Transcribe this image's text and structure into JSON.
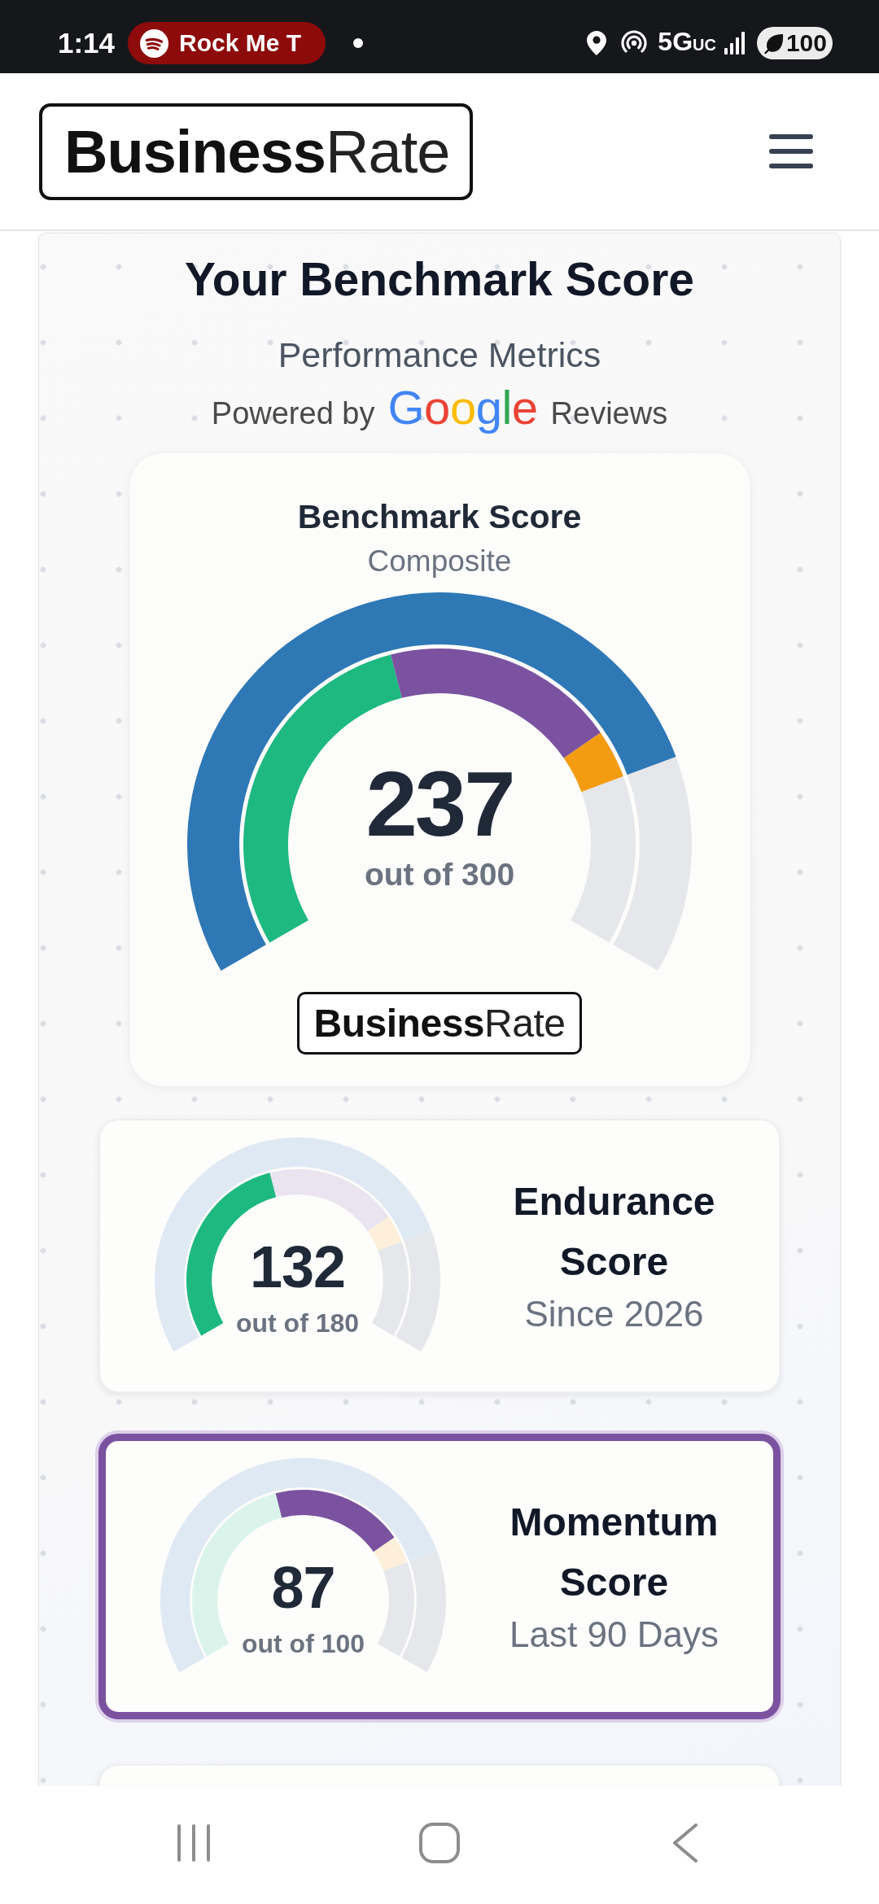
{
  "status_bar": {
    "time": "1:14",
    "media_title": "Rock Me T",
    "network": "5G",
    "network_suffix": "UC",
    "battery": "100"
  },
  "header": {
    "logo": {
      "bold": "Business",
      "light": "Rate"
    }
  },
  "intro": {
    "title": "Your Benchmark Score",
    "subtitle": "Performance Metrics",
    "powered_by": "Powered by",
    "brand": "Google",
    "source": "Reviews"
  },
  "benchmark": {
    "title": "Benchmark Score",
    "subtitle": "Composite",
    "score": "237",
    "out_of": "out of 300",
    "gauge": {
      "segments": [
        {
          "color": "#1db981"
        },
        {
          "color": "#7b52a0"
        },
        {
          "color": "#f39c12"
        }
      ]
    },
    "logo": {
      "bold": "Business",
      "light": "Rate"
    }
  },
  "score_cards": [
    {
      "title": "Endurance Score",
      "subtitle": "Since 2026",
      "score": "132",
      "out_of": "out of 180",
      "selected": false,
      "gauge": {
        "total_highlighted": false,
        "segments": [
          {
            "highlighted": true
          },
          {
            "highlighted": false
          },
          {
            "highlighted": false
          }
        ]
      }
    },
    {
      "title": "Momentum Score",
      "subtitle": "Last 90 Days",
      "score": "87",
      "out_of": "out of 100",
      "selected": true,
      "gauge": {
        "total_highlighted": false,
        "segments": [
          {
            "highlighted": false
          },
          {
            "highlighted": true
          },
          {
            "highlighted": false
          }
        ]
      }
    }
  ]
}
